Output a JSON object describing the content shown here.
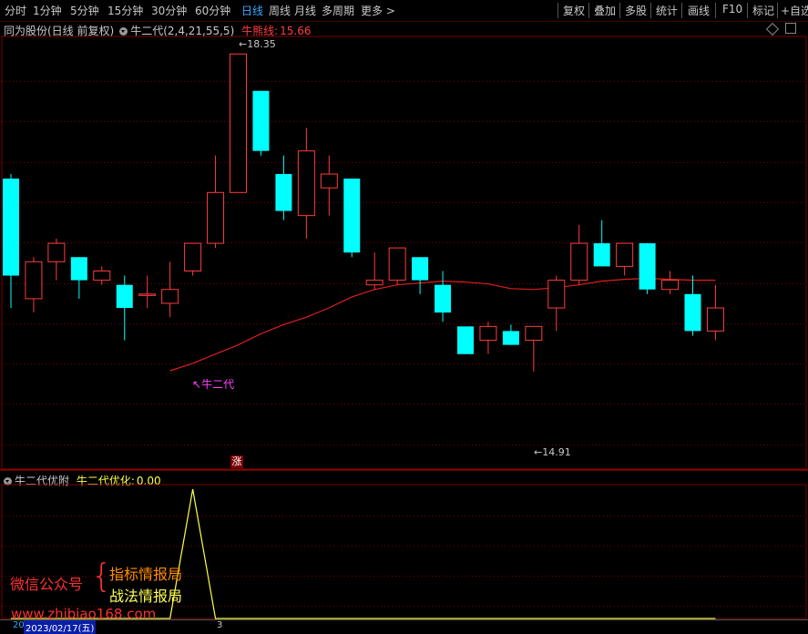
{
  "toolbar": {
    "periods": [
      "分时",
      "1分钟",
      "5分钟",
      "15分钟",
      "30分钟",
      "60分钟",
      "日线",
      "周线",
      "月线",
      "多周期",
      "更多 >"
    ],
    "active_period": "日线",
    "tools": [
      "复权",
      "叠加",
      "多股",
      "统计",
      "画线",
      "F10",
      "标记",
      "+自选"
    ]
  },
  "main_header": {
    "stock": "同为股份(日线 前复权)",
    "indicator": "牛二代(2,4,21,55,5)",
    "line_label": "牛熊线:",
    "line_value": "15.66"
  },
  "sub_header": {
    "indicator": "牛二代优附",
    "label": "牛二代优化:",
    "value": "0.00"
  },
  "annotations": {
    "high_label": "18.35",
    "low_label": "14.91",
    "signal_label": "牛二代",
    "zhang_badge": "涨"
  },
  "watermark": {
    "left": "微信公众号",
    "line1": "指标情报局",
    "line2": "战法情报局",
    "url": "www.zhibiao168.com"
  },
  "bottom_bar": {
    "prefix": "20",
    "date": "2023/02/17(五)",
    "marker": "3"
  },
  "colors": {
    "up": "#ff3c3c",
    "down": "#00ffff",
    "ma": "#dd1e1e",
    "signal": "#ff44ff",
    "oscillator": "#ffff44",
    "grid": "#7a0000",
    "active": "#39a9ff"
  },
  "chart_data": {
    "type": "candlestick",
    "price_axis": {
      "min": 14.2,
      "max": 18.5
    },
    "candles": [
      {
        "o": 17.0,
        "h": 17.05,
        "l": 15.6,
        "c": 15.95
      },
      {
        "o": 15.7,
        "h": 16.15,
        "l": 15.55,
        "c": 16.1
      },
      {
        "o": 16.1,
        "h": 16.35,
        "l": 15.9,
        "c": 16.3
      },
      {
        "o": 16.15,
        "h": 16.15,
        "l": 15.7,
        "c": 15.9
      },
      {
        "o": 15.9,
        "h": 16.05,
        "l": 15.85,
        "c": 16.0
      },
      {
        "o": 15.85,
        "h": 15.95,
        "l": 15.25,
        "c": 15.6
      },
      {
        "o": 15.75,
        "h": 15.95,
        "l": 15.6,
        "c": 15.75
      },
      {
        "o": 15.65,
        "h": 16.1,
        "l": 15.5,
        "c": 15.8
      },
      {
        "o": 16.0,
        "h": 16.3,
        "l": 15.95,
        "c": 16.3
      },
      {
        "o": 16.3,
        "h": 17.25,
        "l": 16.25,
        "c": 16.85
      },
      {
        "o": 16.85,
        "h": 18.35,
        "l": 16.85,
        "c": 18.35
      },
      {
        "o": 17.95,
        "h": 17.95,
        "l": 17.25,
        "c": 17.3
      },
      {
        "o": 17.05,
        "h": 17.25,
        "l": 16.55,
        "c": 16.65
      },
      {
        "o": 16.6,
        "h": 17.55,
        "l": 16.35,
        "c": 17.3
      },
      {
        "o": 16.9,
        "h": 17.25,
        "l": 16.6,
        "c": 17.05
      },
      {
        "o": 17.0,
        "h": 17.0,
        "l": 16.15,
        "c": 16.2
      },
      {
        "o": 15.85,
        "h": 16.2,
        "l": 15.8,
        "c": 15.9
      },
      {
        "o": 15.9,
        "h": 16.25,
        "l": 15.85,
        "c": 16.25
      },
      {
        "o": 16.15,
        "h": 16.15,
        "l": 15.75,
        "c": 15.9
      },
      {
        "o": 15.85,
        "h": 16.0,
        "l": 15.45,
        "c": 15.55
      },
      {
        "o": 15.4,
        "h": 15.4,
        "l": 15.1,
        "c": 15.1
      },
      {
        "o": 15.25,
        "h": 15.45,
        "l": 15.1,
        "c": 15.4
      },
      {
        "o": 15.35,
        "h": 15.42,
        "l": 15.2,
        "c": 15.2
      },
      {
        "o": 15.25,
        "h": 15.4,
        "l": 14.91,
        "c": 15.4
      },
      {
        "o": 15.6,
        "h": 15.95,
        "l": 15.35,
        "c": 15.9
      },
      {
        "o": 15.9,
        "h": 16.5,
        "l": 15.85,
        "c": 16.3
      },
      {
        "o": 16.3,
        "h": 16.55,
        "l": 16.05,
        "c": 16.05
      },
      {
        "o": 16.05,
        "h": 16.3,
        "l": 15.95,
        "c": 16.3
      },
      {
        "o": 16.3,
        "h": 16.3,
        "l": 15.75,
        "c": 15.8
      },
      {
        "o": 15.8,
        "h": 16.0,
        "l": 15.75,
        "c": 15.9
      },
      {
        "o": 15.75,
        "h": 15.95,
        "l": 15.3,
        "c": 15.35
      },
      {
        "o": 15.35,
        "h": 15.85,
        "l": 15.25,
        "c": 15.6
      }
    ],
    "ma_line": [
      null,
      null,
      null,
      null,
      null,
      null,
      null,
      14.92,
      15.0,
      15.1,
      15.2,
      15.32,
      15.42,
      15.5,
      15.6,
      15.72,
      15.8,
      15.85,
      15.87,
      15.89,
      15.88,
      15.86,
      15.81,
      15.8,
      15.82,
      15.85,
      15.89,
      15.91,
      15.92,
      15.91,
      15.9,
      15.9
    ],
    "oscillator": [
      0,
      0,
      0,
      0,
      0,
      0,
      0,
      0,
      1,
      0,
      0,
      0,
      0,
      0,
      0,
      0,
      0,
      0,
      0,
      0,
      0,
      0,
      0,
      0,
      0,
      0,
      0,
      0,
      0,
      0,
      0,
      0
    ]
  }
}
